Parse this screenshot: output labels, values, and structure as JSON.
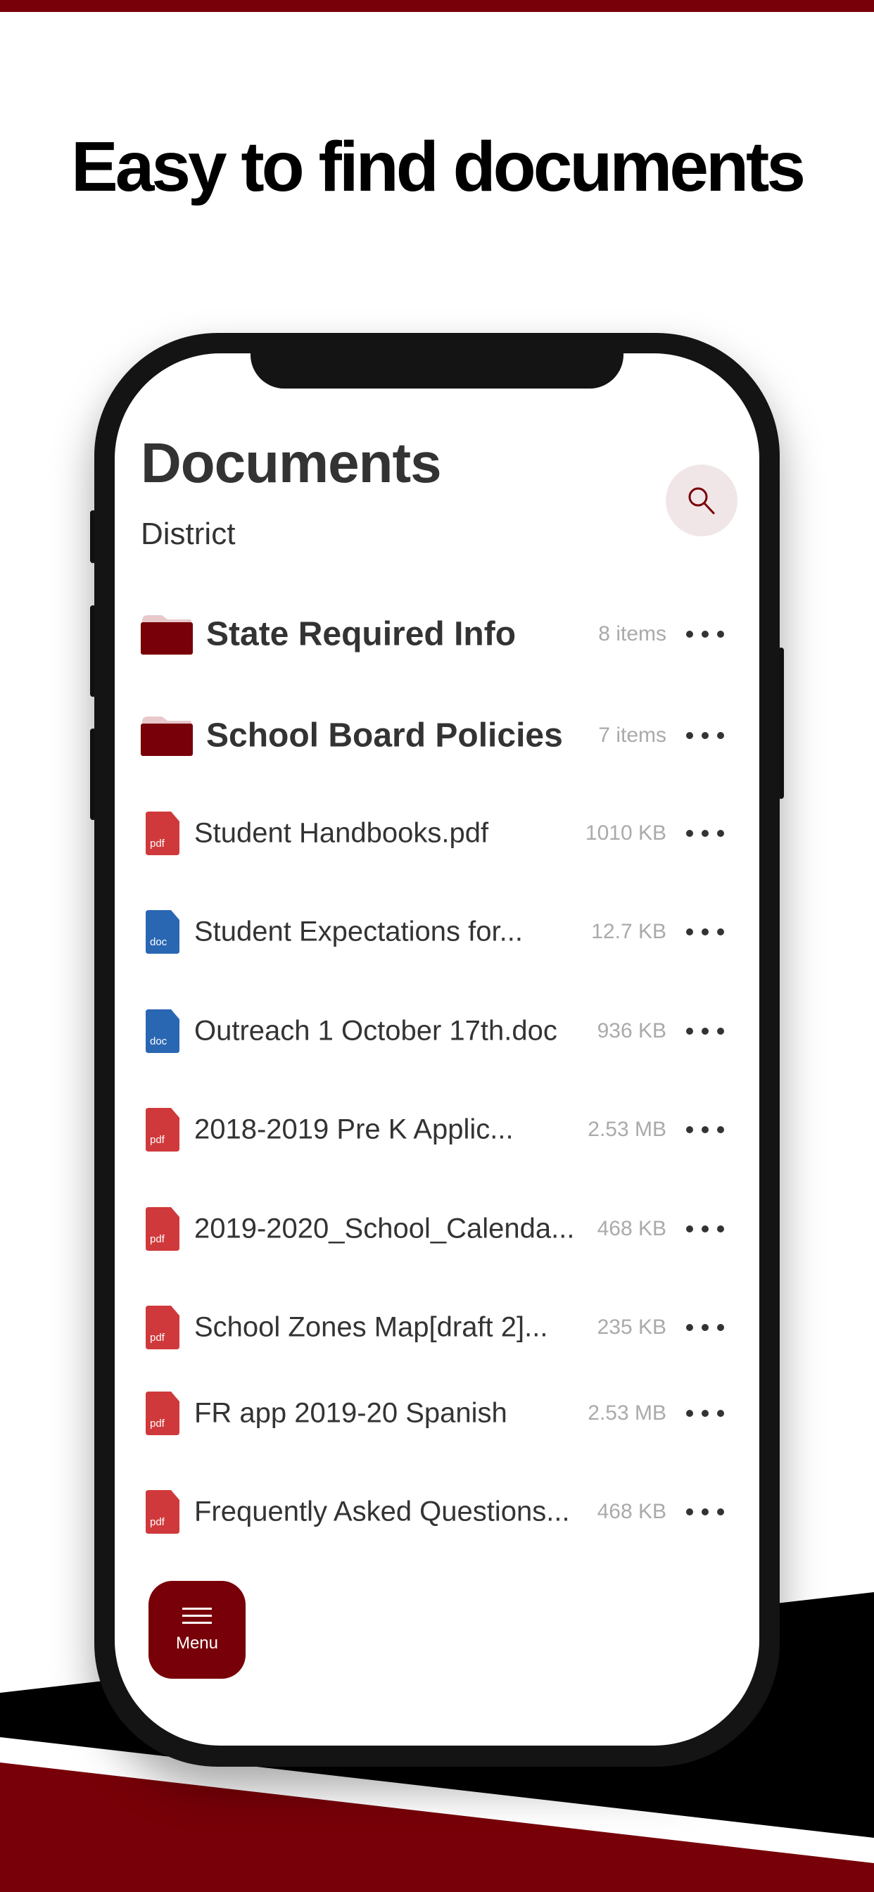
{
  "headline": "Easy to find documents",
  "colors": {
    "brand": "#780008",
    "pdf": "#d0393b",
    "doc": "#2a67b3",
    "folder_tab": "#e8c8cb"
  },
  "app": {
    "title": "Documents",
    "subtitle": "District",
    "search_icon": "search-icon",
    "folders": [
      {
        "name": "State Required Info",
        "meta": "8 items"
      },
      {
        "name": "School Board Policies",
        "meta": "7 items"
      }
    ],
    "files": [
      {
        "name": "Student Handbooks.pdf",
        "size": "1010 KB",
        "type": "pdf"
      },
      {
        "name": "Student Expectations for...",
        "size": "12.7 KB",
        "type": "doc"
      },
      {
        "name": "Outreach 1 October 17th.doc",
        "size": "936 KB",
        "type": "doc"
      },
      {
        "name": "2018-2019 Pre K Applic...",
        "size": "2.53 MB",
        "type": "pdf"
      },
      {
        "name": "2019-2020_School_Calenda...",
        "size": "468 KB",
        "type": "pdf"
      },
      {
        "name": "School Zones Map[draft 2]...",
        "size": "235 KB",
        "type": "pdf"
      },
      {
        "name": "FR app 2019-20 Spanish",
        "size": "2.53 MB",
        "type": "pdf"
      },
      {
        "name": "Frequently Asked Questions...",
        "size": "468 KB",
        "type": "pdf"
      }
    ],
    "menu_label": "Menu"
  }
}
